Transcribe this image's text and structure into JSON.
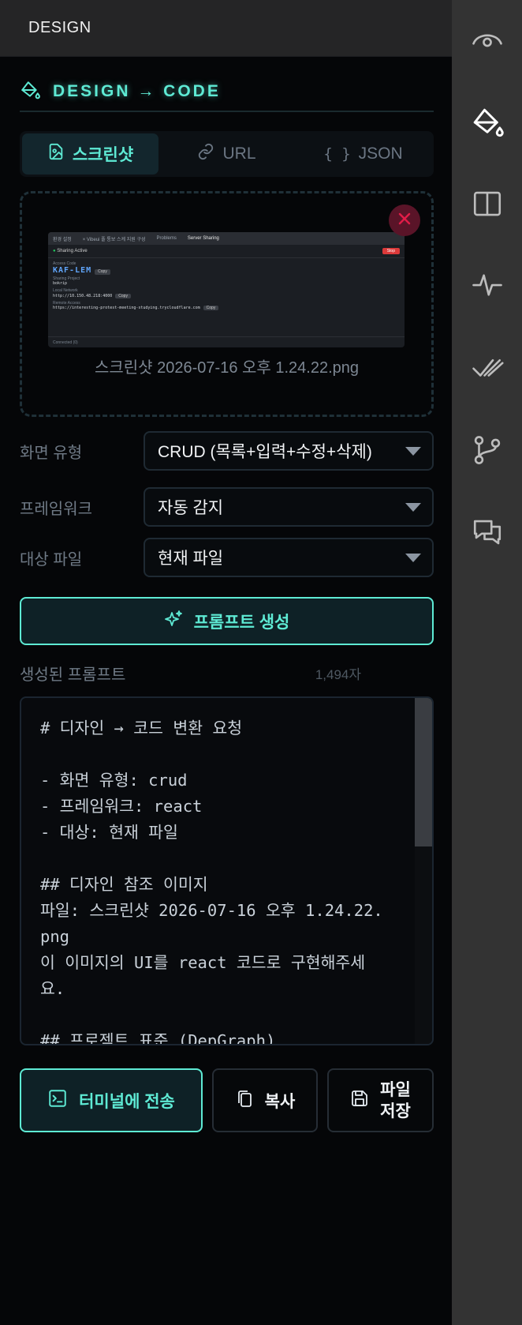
{
  "panel": {
    "header": "DESIGN"
  },
  "title": "DESIGN → CODE",
  "tabs": [
    {
      "label": "스크린샷",
      "icon": "image-upload-icon",
      "active": true
    },
    {
      "label": "URL",
      "icon": "link-icon",
      "active": false
    },
    {
      "label": "JSON",
      "icon": "braces-icon",
      "active": false
    }
  ],
  "upload": {
    "filename": "스크린샷 2026-07-16 오후 1.24.22.png",
    "thumbnail": {
      "tabs": [
        "환경 설정",
        "× Vibeui 폴 통보 스케 지원 구성",
        "Problems",
        "Server Sharing"
      ],
      "status": "Sharing Active",
      "stop": "Stop",
      "access_code_label": "Access Code",
      "access_code": "KAF-LEM",
      "copy": "Copy",
      "project_label": "Sharing Project",
      "project": "bokrip",
      "local_label": "Local Network",
      "local_url": "http://10.150.48.218:4000",
      "remote_label": "Remote Access",
      "remote_url": "https://interesting-protest-meeting-studying.trycloudflare.com",
      "footer": "Connected (0)"
    }
  },
  "form": {
    "screen_type": {
      "label": "화면 유형",
      "value": "CRUD (목록+입력+수정+삭제)"
    },
    "framework": {
      "label": "프레임워크",
      "value": "자동 감지"
    },
    "target": {
      "label": "대상 파일",
      "value": "현재 파일"
    }
  },
  "generate_button": "프롬프트 생성",
  "output": {
    "label": "생성된 프롬프트",
    "char_count": "1,494자",
    "text": "# 디자인 → 코드 변환 요청\n\n- 화면 유형: crud\n- 프레임워크: react\n- 대상: 현재 파일\n\n## 디자인 참조 이미지\n파일: 스크린샷 2026-07-16 오후 1.24.22.png\n이 이미지의 UI를 react 코드로 구현해주세요.\n\n## 프로젝트 표준 (DepGraph)"
  },
  "actions": {
    "send_terminal": "터미널에 전송",
    "copy": "복사",
    "save_line1": "파일",
    "save_line2": "저장"
  },
  "colors": {
    "accent": "#5eead4",
    "danger": "#e11d48",
    "background": "#050608"
  }
}
